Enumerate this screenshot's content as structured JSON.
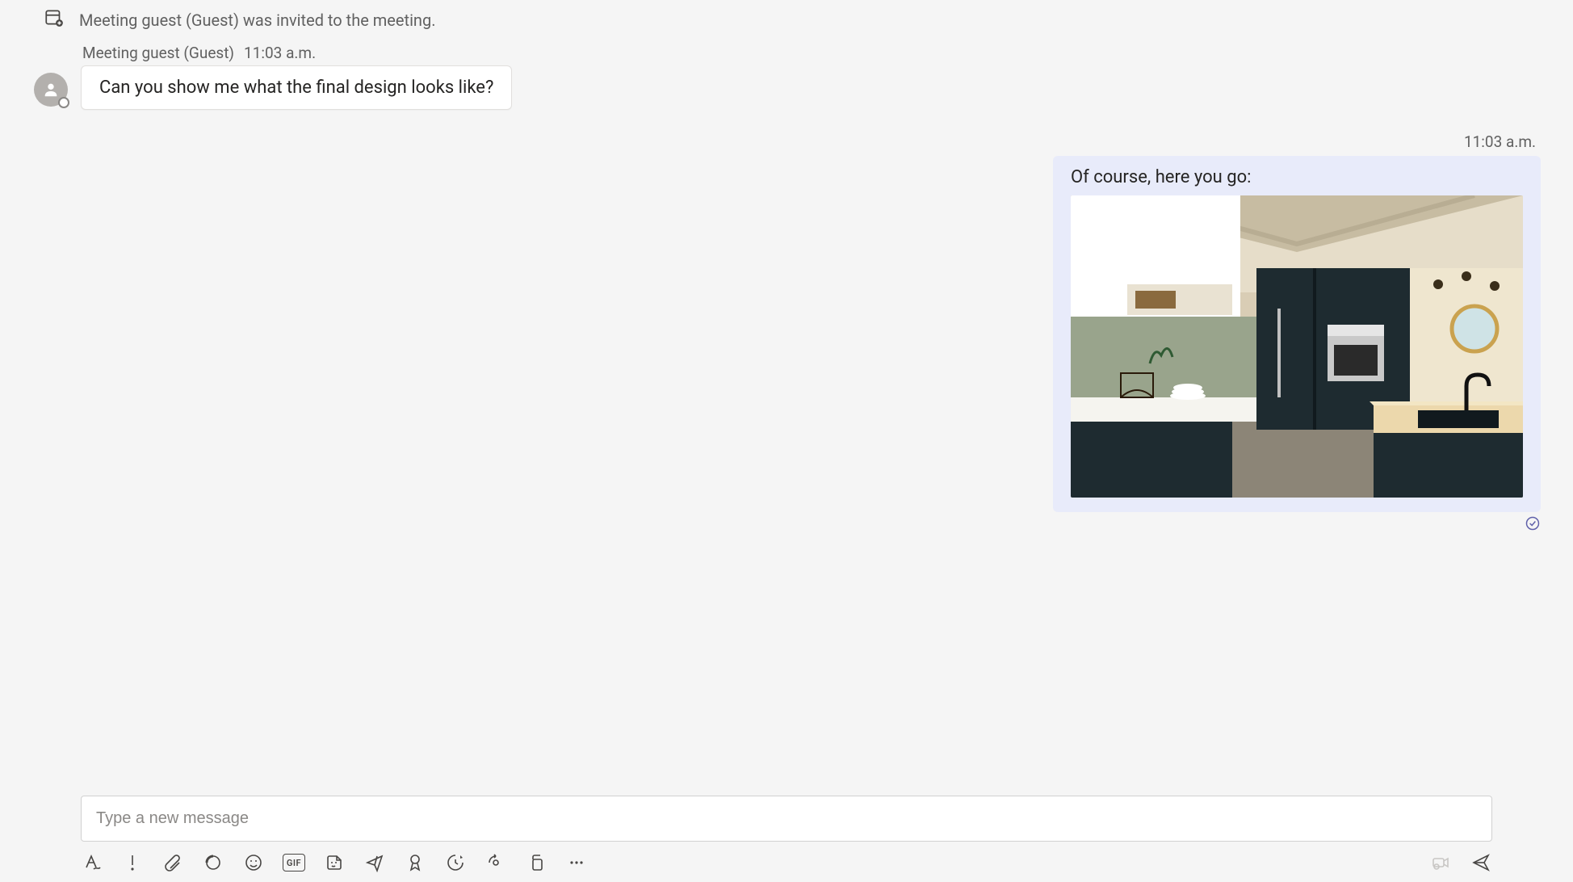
{
  "system_event": {
    "text": "Meeting guest (Guest) was invited to the meeting."
  },
  "incoming": {
    "sender": "Meeting guest (Guest)",
    "time": "11:03 a.m.",
    "body": "Can you show me what the final design looks like?"
  },
  "outgoing": {
    "time": "11:03 a.m.",
    "body": "Of course, here you go:",
    "attachment_alt": "Modern kitchen interior render"
  },
  "composer": {
    "placeholder": "Type a new message",
    "gif_label": "GIF"
  }
}
